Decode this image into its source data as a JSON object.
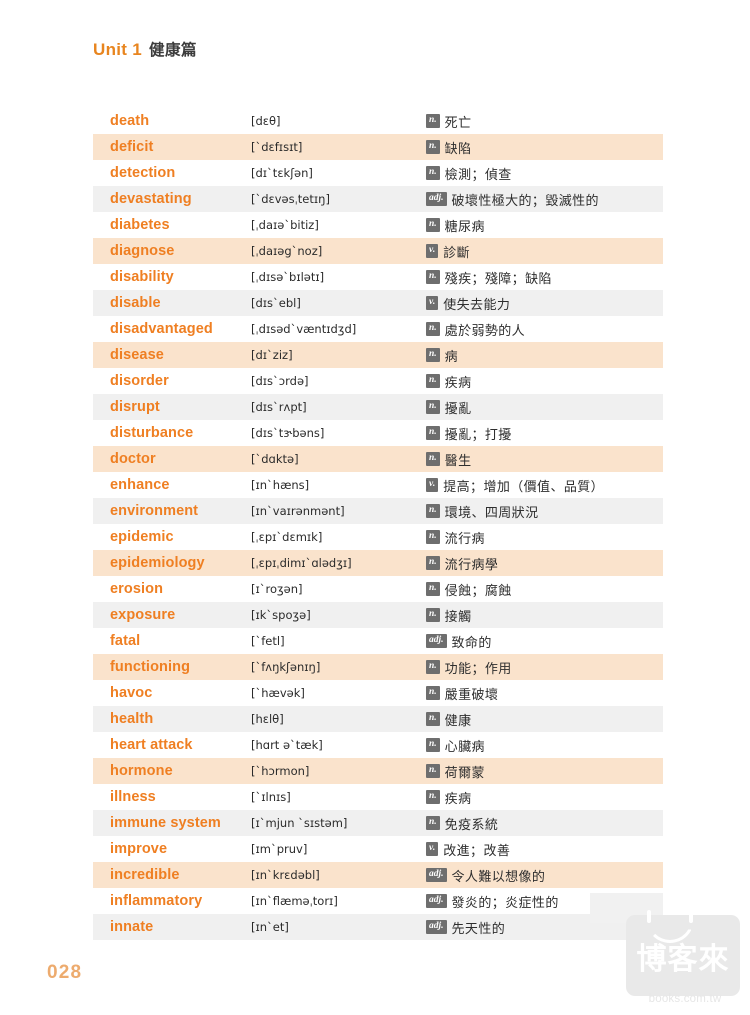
{
  "header": {
    "unit_label": "Unit 1",
    "topic": "健康篇"
  },
  "page": {
    "number": "028"
  },
  "watermark": {
    "brand": "博客來",
    "url": "books.com.tw",
    "icon": "smile-bowl-icon"
  },
  "vocab": {
    "rows": [
      {
        "word": "death",
        "ipa": "[dɛθ]",
        "pos": "n.",
        "meaning": "死亡"
      },
      {
        "word": "deficit",
        "ipa": "[ˋdɛfɪsɪt]",
        "pos": "n.",
        "meaning": "缺陷"
      },
      {
        "word": "detection",
        "ipa": "[dɪˋtɛkʃən]",
        "pos": "n.",
        "meaning": "檢測；偵查"
      },
      {
        "word": "devastating",
        "ipa": "[ˋdɛvəsˌtetɪŋ]",
        "pos": "adj.",
        "meaning": "破壞性極大的；毀滅性的"
      },
      {
        "word": "diabetes",
        "ipa": "[ˌdaɪəˋbitiz]",
        "pos": "n.",
        "meaning": "糖尿病"
      },
      {
        "word": "diagnose",
        "ipa": "[ˌdaɪəgˋnoz]",
        "pos": "v.",
        "meaning": "診斷"
      },
      {
        "word": "disability",
        "ipa": "[ˌdɪsəˋbɪlətɪ]",
        "pos": "n.",
        "meaning": "殘疾；殘障；缺陷"
      },
      {
        "word": "disable",
        "ipa": "[dɪsˋebl]",
        "pos": "v.",
        "meaning": "使失去能力"
      },
      {
        "word": "disadvantaged",
        "ipa": "[ˌdɪsədˋvæntɪdʒd]",
        "pos": "n.",
        "meaning": "處於弱勢的人"
      },
      {
        "word": "disease",
        "ipa": "[dɪˋziz]",
        "pos": "n.",
        "meaning": "病"
      },
      {
        "word": "disorder",
        "ipa": "[dɪsˋɔrdə]",
        "pos": "n.",
        "meaning": "疾病"
      },
      {
        "word": "disrupt",
        "ipa": "[dɪsˋrʌpt]",
        "pos": "n.",
        "meaning": "擾亂"
      },
      {
        "word": "disturbance",
        "ipa": "[dɪsˋtɝbəns]",
        "pos": "n.",
        "meaning": "擾亂；打擾"
      },
      {
        "word": "doctor",
        "ipa": "[ˋdɑktə]",
        "pos": "n.",
        "meaning": "醫生"
      },
      {
        "word": "enhance",
        "ipa": "[ɪnˋhæns]",
        "pos": "v.",
        "meaning": "提高；增加（價值、品質）"
      },
      {
        "word": "environment",
        "ipa": "[ɪnˋvaɪrənmənt]",
        "pos": "n.",
        "meaning": "環境、四周狀況"
      },
      {
        "word": "epidemic",
        "ipa": "[ˌɛpɪˋdɛmɪk]",
        "pos": "n.",
        "meaning": "流行病"
      },
      {
        "word": "epidemiology",
        "ipa": "[ˌɛpɪˌdimɪˋɑlədʒɪ]",
        "pos": "n.",
        "meaning": "流行病學"
      },
      {
        "word": "erosion",
        "ipa": "[ɪˋroʒən]",
        "pos": "n.",
        "meaning": "侵蝕；腐蝕"
      },
      {
        "word": "exposure",
        "ipa": "[ɪkˋspoʒə]",
        "pos": "n.",
        "meaning": "接觸"
      },
      {
        "word": "fatal",
        "ipa": "[ˋfetl]",
        "pos": "adj.",
        "meaning": "致命的"
      },
      {
        "word": "functioning",
        "ipa": "[ˋfʌŋkʃənɪŋ]",
        "pos": "n.",
        "meaning": "功能；作用"
      },
      {
        "word": "havoc",
        "ipa": "[ˋhævək]",
        "pos": "n.",
        "meaning": "嚴重破壞"
      },
      {
        "word": "health",
        "ipa": "[hɛlθ]",
        "pos": "n.",
        "meaning": "健康"
      },
      {
        "word": "heart attack",
        "ipa": "[hɑrt əˋtæk]",
        "pos": "n.",
        "meaning": "心臟病"
      },
      {
        "word": "hormone",
        "ipa": "[ˋhɔrmon]",
        "pos": "n.",
        "meaning": "荷爾蒙"
      },
      {
        "word": "illness",
        "ipa": "[ˋɪlnɪs]",
        "pos": "n.",
        "meaning": "疾病"
      },
      {
        "word": "immune system",
        "ipa": "[ɪˋmjun ˋsɪstəm]",
        "pos": "n.",
        "meaning": "免疫系統"
      },
      {
        "word": "improve",
        "ipa": "[ɪmˋpruv]",
        "pos": "v.",
        "meaning": "改進；改善"
      },
      {
        "word": "incredible",
        "ipa": "[ɪnˋkrɛdəbl]",
        "pos": "adj.",
        "meaning": "令人難以想像的"
      },
      {
        "word": "inflammatory",
        "ipa": "[ɪnˋflæməˌtorɪ]",
        "pos": "adj.",
        "meaning": "發炎的；炎症性的"
      },
      {
        "word": "innate",
        "ipa": "[ɪnˋet]",
        "pos": "adj.",
        "meaning": "先天性的"
      }
    ]
  },
  "colors": {
    "word_orange": "#ef7f22",
    "unit_orange": "#e8851f",
    "page_number_orange": "#edab6e",
    "row_tint_peach": "#fae3cc",
    "row_tint_gray": "#f0f0f0",
    "badge_gray": "#6e6e6e"
  }
}
